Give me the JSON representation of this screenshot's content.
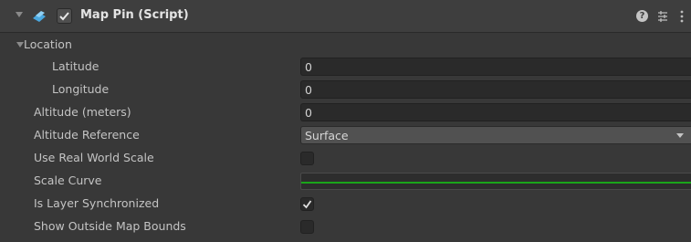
{
  "component": {
    "title": "Map Pin (Script)",
    "enabled": true,
    "icons": {
      "fold": "triangle-down-icon",
      "script": "script-icon",
      "help": "help-icon",
      "presets": "presets-icon",
      "menu": "kebab-menu-icon"
    }
  },
  "location": {
    "label": "Location",
    "latitude": {
      "label": "Latitude",
      "value": "0"
    },
    "longitude": {
      "label": "Longitude",
      "value": "0"
    }
  },
  "altitude": {
    "label": "Altitude (meters)",
    "value": "0"
  },
  "altitude_reference": {
    "label": "Altitude Reference",
    "value": "Surface"
  },
  "use_real_world_scale": {
    "label": "Use Real World Scale",
    "checked": false
  },
  "scale_curve": {
    "label": "Scale Curve",
    "curve_color": "#1aa51a"
  },
  "is_layer_synchronized": {
    "label": "Is Layer Synchronized",
    "checked": true
  },
  "show_outside_map_bounds": {
    "label": "Show Outside Map Bounds",
    "checked": false
  },
  "colors": {
    "background": "#383838",
    "header": "#3e3e3e",
    "field": "#2a2a2a",
    "dropdown": "#515151",
    "text": "#c4c4c4",
    "script_icon": "#4aa8e0"
  }
}
